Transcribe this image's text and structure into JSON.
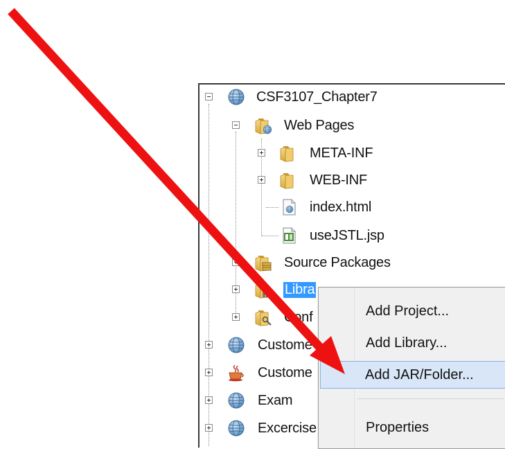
{
  "tree": {
    "project": "CSF3107_Chapter7",
    "web_pages": "Web Pages",
    "meta_inf": "META-INF",
    "web_inf": "WEB-INF",
    "index_html": "index.html",
    "use_jstl": "useJSTL.jsp",
    "source_packages": "Source Packages",
    "libraries": "Libra",
    "conf_files": "Conf",
    "customer_1": "Custome",
    "customer_2": "Custome",
    "exam": "Exam",
    "exercise": "Excercise"
  },
  "context_menu": {
    "add_project": "Add Project...",
    "add_library": "Add Library...",
    "add_jar_folder": "Add JAR/Folder...",
    "properties": "Properties"
  },
  "colors": {
    "arrow": "#ee1111",
    "selection": "#3399ff",
    "menu_highlight": "#d8e6f7",
    "folder": "#e8c05a"
  },
  "icons": {
    "project": "globe-icon",
    "folder": "folder-icon",
    "java_project": "coffee-cup-icon",
    "file": "document-icon"
  }
}
